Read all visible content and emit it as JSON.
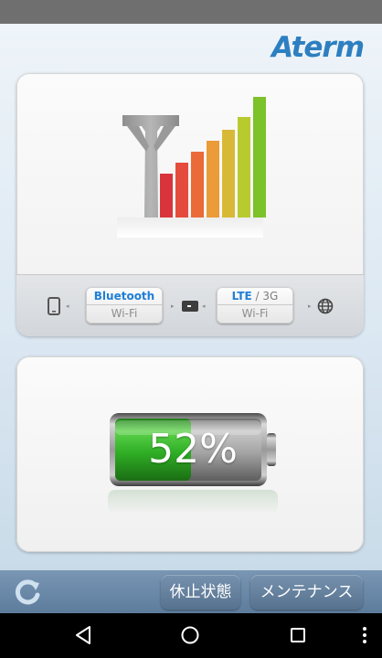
{
  "app": {
    "logo_text": "Aterm",
    "accent_color": "#2d7fc0"
  },
  "signal": {
    "bars_lit": 7,
    "bars_total": 7,
    "bar_colors": [
      "#d9343b",
      "#e54b3c",
      "#ea6a38",
      "#eb9b37",
      "#d8b936",
      "#b7cb2f",
      "#7cc22b"
    ]
  },
  "connection": {
    "device_icon": "phone-icon",
    "chip1": {
      "active": "Bluetooth",
      "inactive": "Wi-Fi"
    },
    "router_icon": "router-icon",
    "chip2": {
      "active": "LTE",
      "separator": " / ",
      "alt": "3G",
      "inactive": "Wi-Fi"
    },
    "internet_icon": "globe-icon"
  },
  "battery": {
    "percent_label": "52%",
    "level": 0.52,
    "fill_color": "#2fae25"
  },
  "toolbar": {
    "refresh_icon": "refresh-icon",
    "pause_label": "休止状態",
    "maintenance_label": "メンテナンス"
  },
  "navigation": {
    "back_icon": "back-triangle-icon",
    "home_icon": "home-circle-icon",
    "recents_icon": "recents-square-icon",
    "menu_icon": "overflow-menu-icon"
  }
}
